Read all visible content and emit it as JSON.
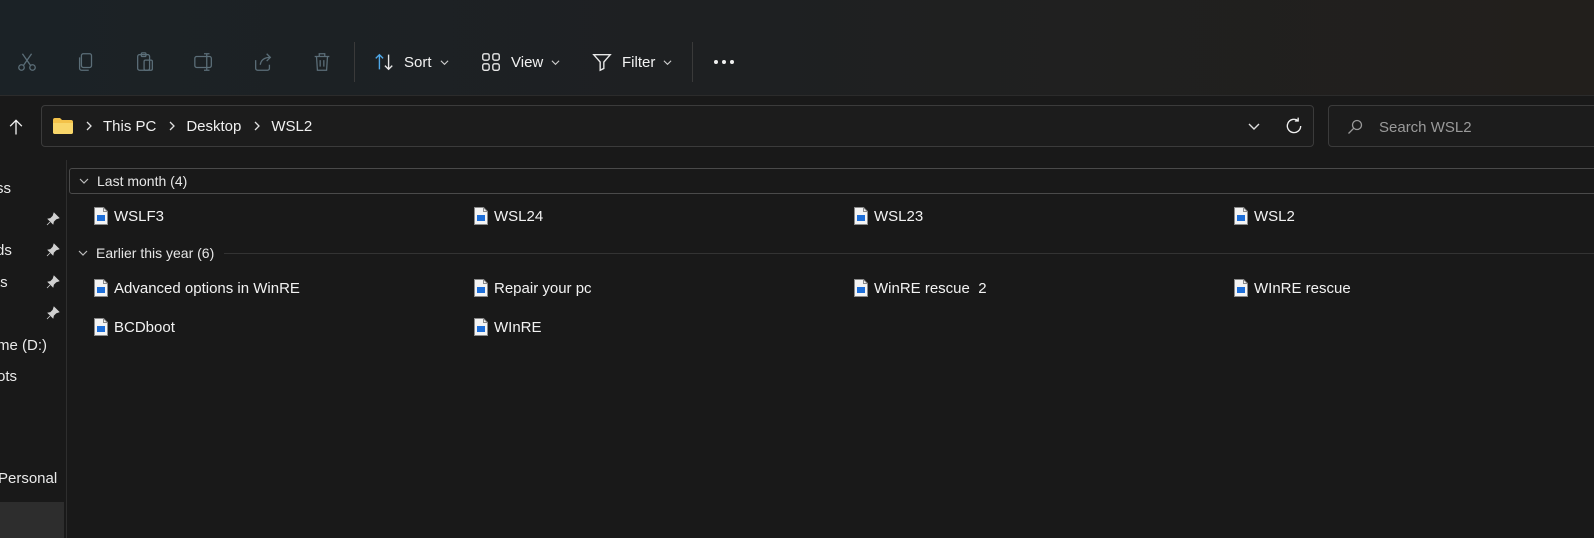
{
  "toolbar": {
    "icons": [
      "cut-icon",
      "copy-icon",
      "paste-icon",
      "rename-icon",
      "share-icon",
      "delete-icon"
    ],
    "sort_label": "Sort",
    "view_label": "View",
    "filter_label": "Filter",
    "more_icon": "more-icon"
  },
  "address": {
    "crumbs": [
      "This PC",
      "Desktop",
      "WSL2"
    ],
    "folder_icon": "folder-icon",
    "folder_color": "#f3c24a"
  },
  "search": {
    "placeholder": "Search WSL2"
  },
  "nav": {
    "items": [
      {
        "label": "ss",
        "pinned": false
      },
      {
        "label": "",
        "pinned": true
      },
      {
        "label": "ds",
        "pinned": true
      },
      {
        "label": "ts",
        "pinned": true
      },
      {
        "label": "",
        "pinned": true
      },
      {
        "label": "me (D:)",
        "pinned": false
      },
      {
        "label": "ots",
        "pinned": false
      },
      {
        "label": " Personal",
        "pinned": false
      }
    ]
  },
  "groups": [
    {
      "title": "Last month (4)",
      "files": [
        "WSLF3",
        "WSL24",
        "WSL23",
        "WSL2"
      ]
    },
    {
      "title": "Earlier this year (6)",
      "files": [
        "Advanced options in WinRE",
        "Repair your pc",
        "WinRE rescue  2",
        "WInRE rescue",
        "BCDboot",
        "WInRE"
      ]
    }
  ],
  "colors": {
    "background": "#191919",
    "file_icon_accent": "#1e6fd9"
  }
}
